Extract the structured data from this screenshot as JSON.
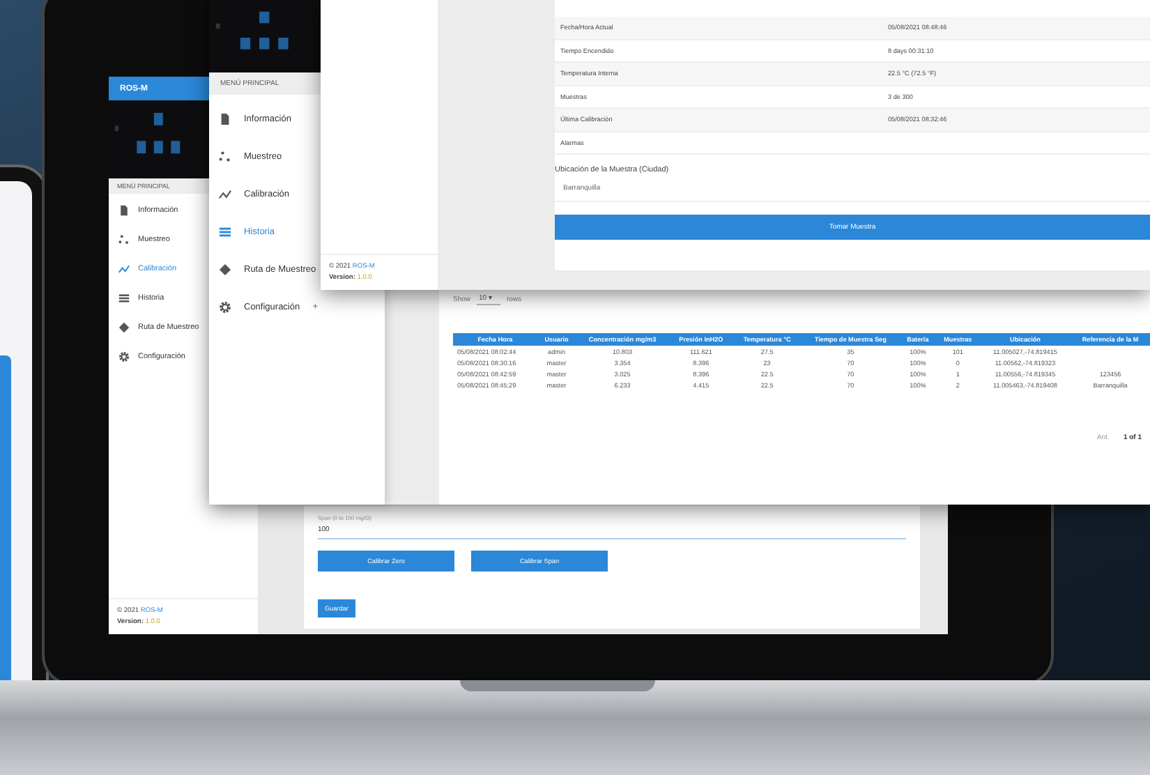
{
  "laptop_app": {
    "brand": "ROS-M",
    "menu_heading": "MENÚ PRINCIPAL",
    "menu": [
      {
        "label": "Información",
        "kind": "document",
        "selected": false
      },
      {
        "label": "Muestreo",
        "kind": "scatter",
        "selected": false
      },
      {
        "label": "Calibración",
        "kind": "trend",
        "selected": true
      },
      {
        "label": "Historia",
        "kind": "list",
        "selected": false
      },
      {
        "label": "Ruta de Muestreo",
        "kind": "route",
        "selected": false
      },
      {
        "label": "Configuración",
        "kind": "gear",
        "selected": false
      }
    ],
    "footer": {
      "copyright": "© 2021",
      "brand": "ROS-M",
      "version_label": "Version:",
      "version": "1.0.0"
    },
    "form": {
      "field_label": "Span (0 to 100 mg/l3)",
      "field_value": "100",
      "buttons": [
        "Calibrar Zero",
        "Calibrar Span"
      ],
      "save": "Guardar"
    }
  },
  "history_window": {
    "menu_heading": "MENÚ PRINCIPAL",
    "menu": [
      {
        "label": "Información",
        "kind": "document",
        "selected": false
      },
      {
        "label": "Muestreo",
        "kind": "scatter",
        "selected": false
      },
      {
        "label": "Calibración",
        "kind": "trend",
        "selected": false
      },
      {
        "label": "Historia",
        "kind": "list",
        "selected": true
      },
      {
        "label": "Ruta de Muestreo",
        "kind": "route",
        "selected": false
      },
      {
        "label": "Configuración",
        "kind": "gear",
        "selected": false,
        "expander": "+"
      }
    ],
    "show_label": "Show",
    "rows_per_page": "10",
    "dropdown_caret": "▾",
    "rows_label": "rows",
    "table": {
      "columns": [
        "Fecha Hora",
        "Usuario",
        "Concentración mg/m3",
        "Presión InH2O",
        "Temperatura °C",
        "Tiempo de Muestra Seg",
        "Batería",
        "Muestras",
        "Ubicación",
        "Referencia de la M"
      ],
      "rows": [
        [
          "05/08/2021 08:02:44",
          "admin",
          "10.803",
          "111.621",
          "27.5",
          "35",
          "100%",
          "101",
          "11.005027,-74.819415",
          null
        ],
        [
          "05/08/2021 08:30:16",
          "master",
          "3.354",
          "8.396",
          "23",
          "70",
          "100%",
          "0",
          "11.00562,-74.819323",
          null
        ],
        [
          "05/08/2021 08:42:59",
          "master",
          "3.025",
          "8.396",
          "22.5",
          "70",
          "100%",
          "1",
          "11.00556,-74.819345",
          "123456"
        ],
        [
          "05/08/2021 08:45:29",
          "master",
          "6.233",
          "4.415",
          "22.5",
          "70",
          "100%",
          "2",
          "11.005463,-74.819408",
          "Barranquilla"
        ]
      ]
    },
    "pagination": {
      "prev": "Ant.",
      "page": "1 of 1"
    }
  },
  "status_window": {
    "footer": {
      "copyright": "© 2021",
      "brand": "ROS-M",
      "version_label": "Version:",
      "version": "1.0.0"
    },
    "info_rows": [
      {
        "label": "Fecha/Hora Actual",
        "value": "05/08/2021 08:48:46"
      },
      {
        "label": "Tiempo Encendido",
        "value": "8 days 00:31:10"
      },
      {
        "label": "Temperatura Interna",
        "value": "22.5 °C (72.5 °F)"
      },
      {
        "label": "Muestras",
        "value": "3 de 300"
      },
      {
        "label": "Última Calibración",
        "value": "05/08/2021 08:32:46"
      },
      {
        "label": "Alarmas",
        "value": null
      }
    ],
    "location_label": "Ubicación de la Muestra (Ciudad)",
    "location_value": "Barranquilla",
    "button": "Tomar Muestra"
  }
}
